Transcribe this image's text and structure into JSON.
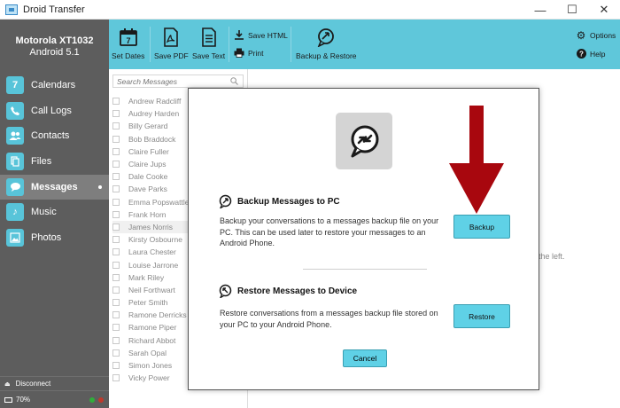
{
  "window": {
    "title": "Droid Transfer",
    "controls": {
      "minimize": "—",
      "maximize": "☐",
      "close": "✕"
    }
  },
  "device": {
    "name": "Motorola XT1032",
    "os": "Android 5.1"
  },
  "sidebar": {
    "items": [
      {
        "label": "Calendars",
        "icon": "calendar-icon"
      },
      {
        "label": "Call Logs",
        "icon": "phone-icon"
      },
      {
        "label": "Contacts",
        "icon": "contacts-icon"
      },
      {
        "label": "Files",
        "icon": "files-icon"
      },
      {
        "label": "Messages",
        "icon": "messages-icon",
        "active": true
      },
      {
        "label": "Music",
        "icon": "music-icon"
      },
      {
        "label": "Photos",
        "icon": "photos-icon"
      }
    ],
    "disconnect_label": "Disconnect",
    "battery_label": "70%",
    "status_colors": [
      "#2fae3a",
      "#c0392b"
    ]
  },
  "toolbar": {
    "set_dates": "Set Dates",
    "save_pdf": "Save PDF",
    "save_text": "Save Text",
    "save_html": "Save HTML",
    "print": "Print",
    "backup_restore": "Backup & Restore",
    "options": "Options",
    "help": "Help"
  },
  "messages_list": {
    "search_placeholder": "Search Messages",
    "contacts": [
      "Andrew Radcliff",
      "Audrey Harden",
      "Billy Gerard",
      "Bob Braddock",
      "Claire Fuller",
      "Claire Jups",
      "Dale Cooke",
      "Dave Parks",
      "Emma Popswattle",
      "Frank Horn",
      "James Norris",
      "Kirsty Osbourne",
      "Laura Chester",
      "Louise Jarrone",
      "Mark Riley",
      "Neil Forthwart",
      "Peter Smith",
      "Ramone Derricks",
      "Ramone Piper",
      "Richard Abbot",
      "Sarah Opal",
      "Simon Jones",
      "Vicky Power"
    ],
    "selected_index": 10
  },
  "main": {
    "hint_text": "the left."
  },
  "modal": {
    "backup": {
      "title": "Backup Messages to PC",
      "text": "Backup your conversations to a messages backup file on your PC. This can be used later to restore your messages to an Android Phone.",
      "button": "Backup"
    },
    "restore": {
      "title": "Restore Messages to Device",
      "text": "Restore conversations from a messages backup file stored on your PC to your Android Phone.",
      "button": "Restore"
    },
    "cancel": "Cancel"
  },
  "colors": {
    "accent": "#5fc7da",
    "sidebar": "#5d5d5d",
    "arrow": "#a8070e"
  }
}
